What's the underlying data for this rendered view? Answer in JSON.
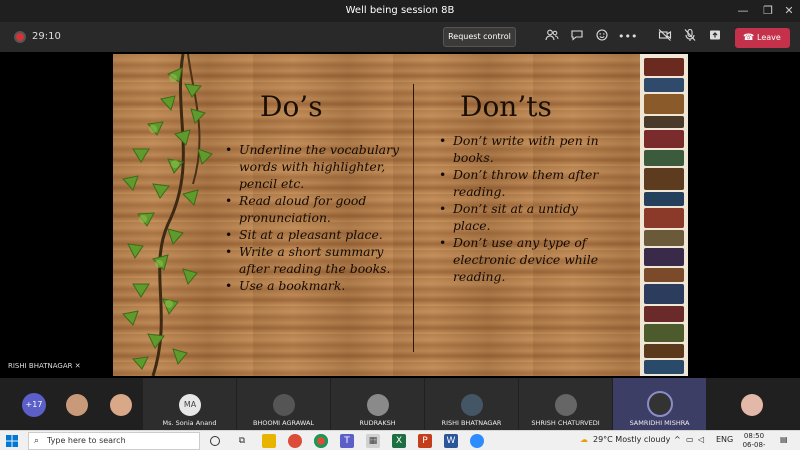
{
  "window": {
    "title": "Well being session 8B"
  },
  "toolbar": {
    "timer": "29:10",
    "request_control_label": "Request control",
    "leave_label": "Leave"
  },
  "slide": {
    "dos_title": "Do’s",
    "donts_title": "Don’ts",
    "dos": [
      "Underline the vocabulary words with highlighter, pencil etc.",
      "Read aloud for good pronunciation.",
      "Sit at a pleasant place.",
      "Write a short summary after reading the books.",
      "Use a bookmark."
    ],
    "donts": [
      "Don’t write with pen in books.",
      "Don’t throw them after reading.",
      "Don’t sit at a untidy place.",
      "Don’t use any type of electronic device while reading."
    ]
  },
  "stage": {
    "speaker_name": "RISHI BHATNAGAR"
  },
  "participants": {
    "overflow_count": "+17",
    "tiles": [
      {
        "name": "Ms. Sonia Anand",
        "initials": "MA"
      },
      {
        "name": "BHOOMI AGRAWAL"
      },
      {
        "name": "RUDRAKSH"
      },
      {
        "name": "RISHI BHATNAGAR"
      },
      {
        "name": "SHRISH CHATURVEDI"
      },
      {
        "name": "SAMRIDHI MISHRA"
      }
    ]
  },
  "taskbar": {
    "search_placeholder": "Type here to search",
    "weather": "29°C  Mostly cloudy",
    "language": "ENG",
    "time": "08:50",
    "date": "06-08-2021"
  },
  "colors": {
    "leave": "#c4314b",
    "accent": "#5b5fc7",
    "recording": "#d13438"
  }
}
